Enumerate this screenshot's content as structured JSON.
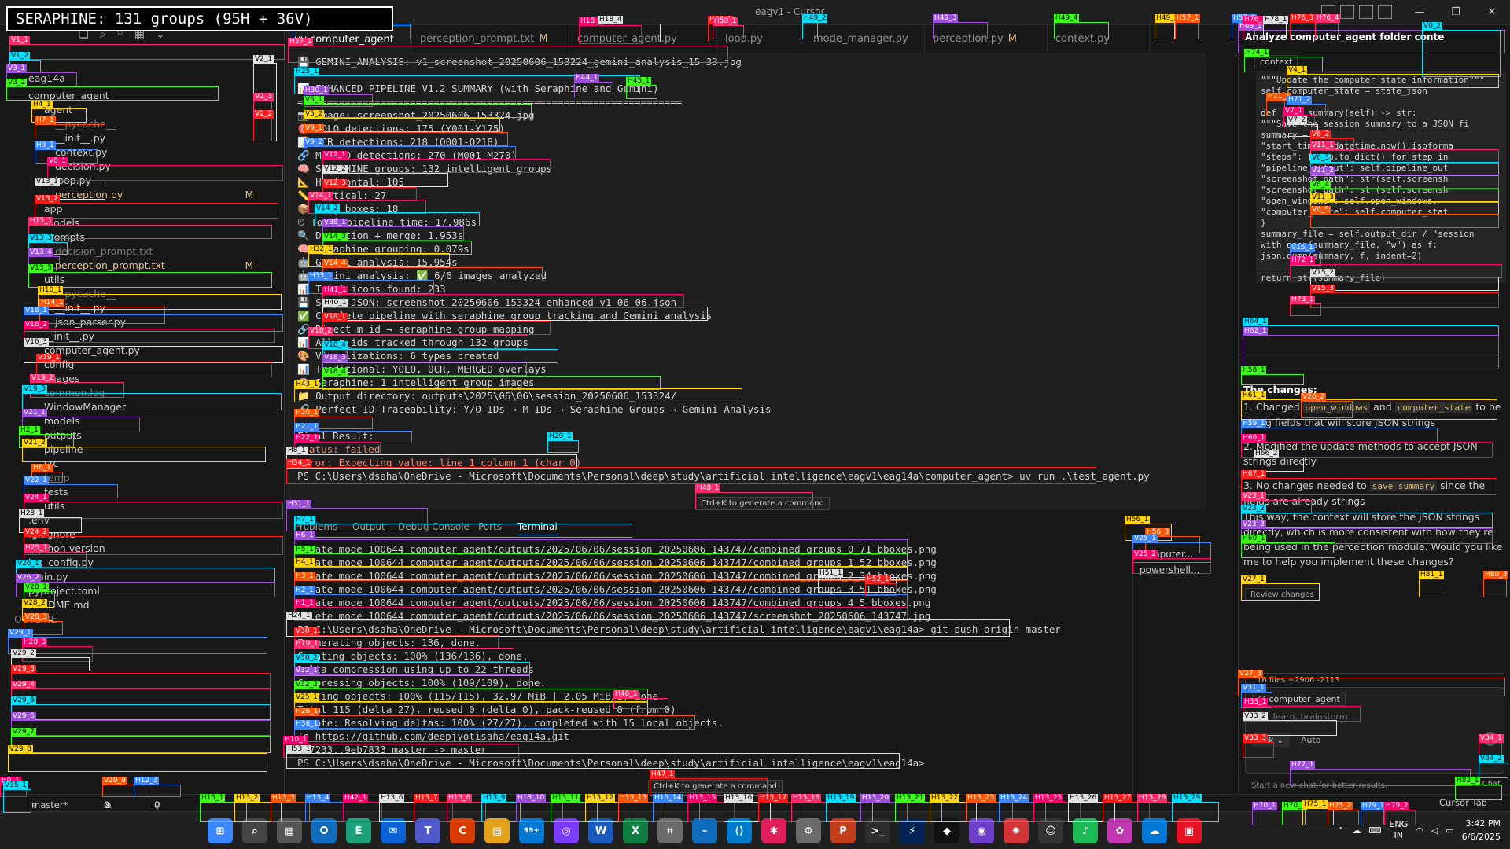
{
  "banner": "SERAPHINE: 131 groups (95H + 36V)",
  "window_title": "eagv1 - Cursor",
  "explorer": {
    "root": "eag14a",
    "items": [
      {
        "label": "computer_agent",
        "dim": false,
        "mod": false
      },
      {
        "label": "agent",
        "dim": false,
        "mod": false
      },
      {
        "label": "__pycache__",
        "dim": true,
        "mod": false
      },
      {
        "label": "__init__.py",
        "dim": false,
        "mod": false
      },
      {
        "label": "context.py",
        "dim": false,
        "mod": false
      },
      {
        "label": "decision.py",
        "dim": false,
        "mod": false
      },
      {
        "label": "loop.py",
        "dim": false,
        "mod": false
      },
      {
        "label": "perception.py",
        "dim": false,
        "mod": true,
        "badge": "M"
      },
      {
        "label": "app",
        "dim": false,
        "mod": false
      },
      {
        "label": "models",
        "dim": false,
        "mod": false
      },
      {
        "label": "prompts",
        "dim": false,
        "mod": false
      },
      {
        "label": "decision_prompt.txt",
        "dim": true,
        "mod": false
      },
      {
        "label": "perception_prompt.txt",
        "dim": false,
        "mod": true,
        "badge": "M"
      },
      {
        "label": "utils",
        "dim": false,
        "mod": false
      },
      {
        "label": "__pycache__",
        "dim": true,
        "mod": false
      },
      {
        "label": "__init__.py",
        "dim": false,
        "mod": false
      },
      {
        "label": "json_parser.py",
        "dim": false,
        "mod": false
      },
      {
        "label": "__init__.py",
        "dim": false,
        "mod": false
      },
      {
        "label": "computer_agent.py",
        "dim": false,
        "mod": false
      },
      {
        "label": "config",
        "dim": false,
        "mod": false
      },
      {
        "label": "images",
        "dim": false,
        "mod": false
      },
      {
        "label": "common.log",
        "dim": true,
        "mod": false
      },
      {
        "label": "WindowManager",
        "dim": false,
        "mod": false
      },
      {
        "label": "models",
        "dim": false,
        "mod": false
      },
      {
        "label": "outputs",
        "dim": false,
        "mod": false
      },
      {
        "label": "pipeline",
        "dim": false,
        "mod": false
      },
      {
        "label": "src",
        "dim": false,
        "mod": false
      },
      {
        "label": "temp",
        "dim": true,
        "mod": false
      },
      {
        "label": "tests",
        "dim": false,
        "mod": false
      },
      {
        "label": "utils",
        "dim": false,
        "mod": false
      },
      {
        "label": ".env",
        "dim": false,
        "mod": false
      },
      {
        "label": ".gitignore",
        "dim": false,
        "mod": false
      },
      {
        "label": ".python-version",
        "dim": false,
        "mod": false
      },
      {
        "label": "log_config.py",
        "dim": false,
        "mod": false
      },
      {
        "label": "main.py",
        "dim": false,
        "mod": false
      },
      {
        "label": "pyproject.toml",
        "dim": false,
        "mod": false
      },
      {
        "label": "README.md",
        "dim": false,
        "mod": false
      },
      {
        "label": "OUTLINE",
        "dim": true,
        "mod": false
      }
    ]
  },
  "tabs": [
    {
      "label": "uv computer_agent",
      "active": true,
      "mod": ""
    },
    {
      "label": "perception_prompt.txt",
      "active": false,
      "mod": "M"
    },
    {
      "label": "computer_agent.py",
      "active": false,
      "mod": ""
    },
    {
      "label": "loop.py",
      "active": false,
      "mod": ""
    },
    {
      "label": "mode_manager.py",
      "active": false,
      "mod": ""
    },
    {
      "label": "perception.py",
      "active": false,
      "mod": "M"
    },
    {
      "label": "context.py",
      "active": false,
      "mod": ""
    }
  ],
  "editor_lines": [
    "💾 GEMINI_ANALYSIS: v1_screenshot_20250606_153224_gemini_analysis_15-33.jpg",
    "",
    "📊 ENHANCED PIPELINE V1.2 SUMMARY (with Seraphine and Gemini)",
    "=================================================================",
    "   📷 Image: screenshot_20250606_153324.jpg",
    "   🎯 YOLO detections: 175 (Y001-Y175)",
    "   📝 OCR detections: 218 (O001-O218)",
    "   🔗 MERGED detections: 270 (M001-M270)",
    "   🧠 SERAPHINE groups: 132 intelligent groups",
    "      📐 Horizontal: 105",
    "      📏 Vertical: 27",
    "      📦 Long boxes: 18",
    "   ⏱ Total pipeline time: 17.986s",
    "      🔍 Detection + merge: 1.953s",
    "      🧠 Seraphine grouping: 0.079s",
    "      🤖 Gemini analysis: 15.954s",
    "   🤖 Gemini analysis: ✅ 6/6 images analyzed",
    "      📊 Total icons found: 233",
    "   💾 Saved JSON: screenshot_20250606_153324_enhanced_v1_06-06.json",
    "   ✅ Complete pipeline with seraphine group tracking and Gemini analysis",
    "   🔗 Direct m_id → seraphine_group mapping",
    "   📊 All m_ids tracked through 132 groups",
    "   🎨 Visualizations: 6 types created",
    "      📊 Traditional: YOLO, OCR, MERGED overlays",
    "      🧠 Seraphine: 1 intelligent group images",
    "   📁 Output directory: outputs\\2025\\06\\06\\session_20250606_153324/",
    "   🔗 Perfect ID Traceability: Y/O IDs → M IDs → Seraphine Groups → Gemini Analysis",
    "",
    "Final Result:",
    "Status: failed",
    "Error: Expecting value: line 1 column 1 (char 0)",
    "PS C:\\Users\\dsaha\\OneDrive - Microsoft\\Documents\\Personal\\deep\\study\\artificial intelligence\\eagv1\\eag14a\\computer_agent> uv run .\\test_agent.py"
  ],
  "editor_hint": "Ctrl+K to generate a command",
  "panel_tabs": [
    "Problems",
    "Output",
    "Debug Console",
    "Ports",
    "Terminal"
  ],
  "terminal_lines": [
    "create mode 100644 computer_agent/outputs/2025/06/06/session_20250606_143747/combined_groups_0_71_bboxes.png",
    "create mode 100644 computer_agent/outputs/2025/06/06/session_20250606_143747/combined_groups_1_52_bboxes.png",
    "create mode 100644 computer_agent/outputs/2025/06/06/session_20250606_143747/combined_groups_2_34_bboxes.png",
    "create mode 100644 computer_agent/outputs/2025/06/06/session_20250606_143747/combined_groups_3_51_bboxes.png",
    "create mode 100644 computer_agent/outputs/2025/06/06/session_20250606_143747/combined_groups_4_5_bboxes.png",
    "delete mode 100644 computer_agent/outputs/2025/06/06/session_20250606_143747/screenshot_20250606_143747.jpg",
    "PS C:\\Users\\dsaha\\OneDrive - Microsoft\\Documents\\Personal\\deep\\study\\artificial intelligence\\eagv1\\eag14a> git push origin master",
    "Enumerating objects: 136, done.",
    "Counting objects: 100% (136/136), done.",
    "Delta compression using up to 22 threads",
    "Compressing objects: 100% (109/109), done.",
    "Writing objects: 100% (115/115), 32.97 MiB | 2.05 MiB/s, done.",
    "Total 115 (delta 27), reused 0 (delta 0), pack-reused 0 (from 0)",
    "remote: Resolving deltas: 100% (27/27), completed with 15 local objects.",
    "To https://github.com/deepjyotisaha/eag14a.git",
    "   ed7233..9eb7833  master -> master",
    "PS C:\\Users\\dsaha\\OneDrive - Microsoft\\Documents\\Personal\\deep\\study\\artificial intelligence\\eagv1\\eag14a> "
  ],
  "terminal_hint": "Ctrl+K to generate a command",
  "terminal_list": [
    "computer...",
    "powershell..."
  ],
  "chat": {
    "title": "Analyze computer_agent folder conte",
    "context_label": "context",
    "code_lines": [
      "        \"\"\"Update the computer state information\"\"\"",
      "        self.computer_state = state_json",
      "",
      "    def save_summary(self) -> str:",
      "        \"\"\"Save the session summary to a JSON fi",
      "        summary = {",
      "            \"start_time\": datetime.now().isoforma",
      "            \"steps\": [step.to_dict() for step in",
      "            \"pipeline_output\": self.pipeline_out",
      "            \"screenshot_path\": str(self.screensh",
      "            \"screenshot_path\": str(self.screensh",
      "            \"open_windows\": self.open_windows,",
      "            \"computer_state\": self.computer_stat",
      "        }",
      "        summary_file = self.output_dir / \"session",
      "        with open(summary_file, \"w\") as f:",
      "            json.dump(summary, f, indent=2)",
      "",
      "        return str(summary_file)"
    ],
    "changes_heading": "The changes:",
    "changes": [
      {
        "pre": "1. Changed ",
        "code1": "open_windows",
        "mid": " and ",
        "code2": "computer_state",
        "post": " to be string fields that will store JSON strings"
      },
      {
        "pre": "2. Modified the update methods to accept JSON strings directly",
        "code1": "",
        "mid": "",
        "code2": "",
        "post": ""
      },
      {
        "pre": "3. No changes needed to ",
        "code1": "save_summary",
        "mid": "",
        "code2": "",
        "post": " since the fields are already strings"
      }
    ],
    "closing": "This way, the context will store the JSON strings directly, which is more consistent with how they're being used in the perception module. Would you like me to help you implement these changes?",
    "review_label": "Review changes",
    "files_summary": "16 files +2906 -2113",
    "input_chip": "computer_agent",
    "input_placeholder": "Ask, learn, brainstorm",
    "mode": "Ask",
    "model": "Auto",
    "new_chat_hint": "Start a new chat for better results.",
    "new_chat_label": "New Chat"
  },
  "statusbar": {
    "branch": "master*",
    "errors": "0",
    "warnings": "0",
    "ports": "0",
    "right": "Cursor Tab"
  },
  "taskbar": {
    "icons": [
      {
        "label": "⊞",
        "color": "#3a86ff"
      },
      {
        "label": "⌕",
        "color": "#444"
      },
      {
        "label": "▦",
        "color": "#555"
      },
      {
        "label": "O",
        "color": "#0f6cbd"
      },
      {
        "label": "E",
        "color": "#1aa37a"
      },
      {
        "label": "✉",
        "color": "#0a64d8"
      },
      {
        "label": "T",
        "color": "#5059c9"
      },
      {
        "label": "C",
        "color": "#d83b01"
      },
      {
        "label": "▤",
        "color": "#e3a21a"
      },
      {
        "label": "99+",
        "color": "#0078d4"
      },
      {
        "label": "◎",
        "color": "#7a3cff"
      },
      {
        "label": "W",
        "color": "#185abd"
      },
      {
        "label": "X",
        "color": "#107c41"
      },
      {
        "label": "⌗",
        "color": "#6b6b6b"
      },
      {
        "label": "⌁",
        "color": "#0f6cbd"
      },
      {
        "label": "⟨⟩",
        "color": "#007acc"
      },
      {
        "label": "✱",
        "color": "#e01e5a"
      },
      {
        "label": "⚙",
        "color": "#6b6b6b"
      },
      {
        "label": "P",
        "color": "#c43e1c"
      },
      {
        "label": ">_",
        "color": "#2d2d2d"
      },
      {
        "label": "⚡",
        "color": "#012456"
      },
      {
        "label": "◆",
        "color": "#111"
      },
      {
        "label": "◉",
        "color": "#6e40c9"
      },
      {
        "label": "✸",
        "color": "#d13438"
      },
      {
        "label": "☺",
        "color": "#333"
      },
      {
        "label": "♪",
        "color": "#1db954"
      },
      {
        "label": "✿",
        "color": "#c239b3"
      },
      {
        "label": "☁",
        "color": "#0078d4"
      },
      {
        "label": "▣",
        "color": "#e81123"
      }
    ],
    "lang_top": "ENG",
    "lang_bottom": "IN",
    "time": "3:42 PM",
    "date": "6/6/2025"
  },
  "overlay_colors": [
    "#ff2a6d",
    "#00e1ff",
    "#9d4edd",
    "#39ff14",
    "#ffd60a",
    "#ff5400",
    "#3a86ff",
    "#ff006e",
    "#e0e0e0",
    "#ff1b1b"
  ]
}
